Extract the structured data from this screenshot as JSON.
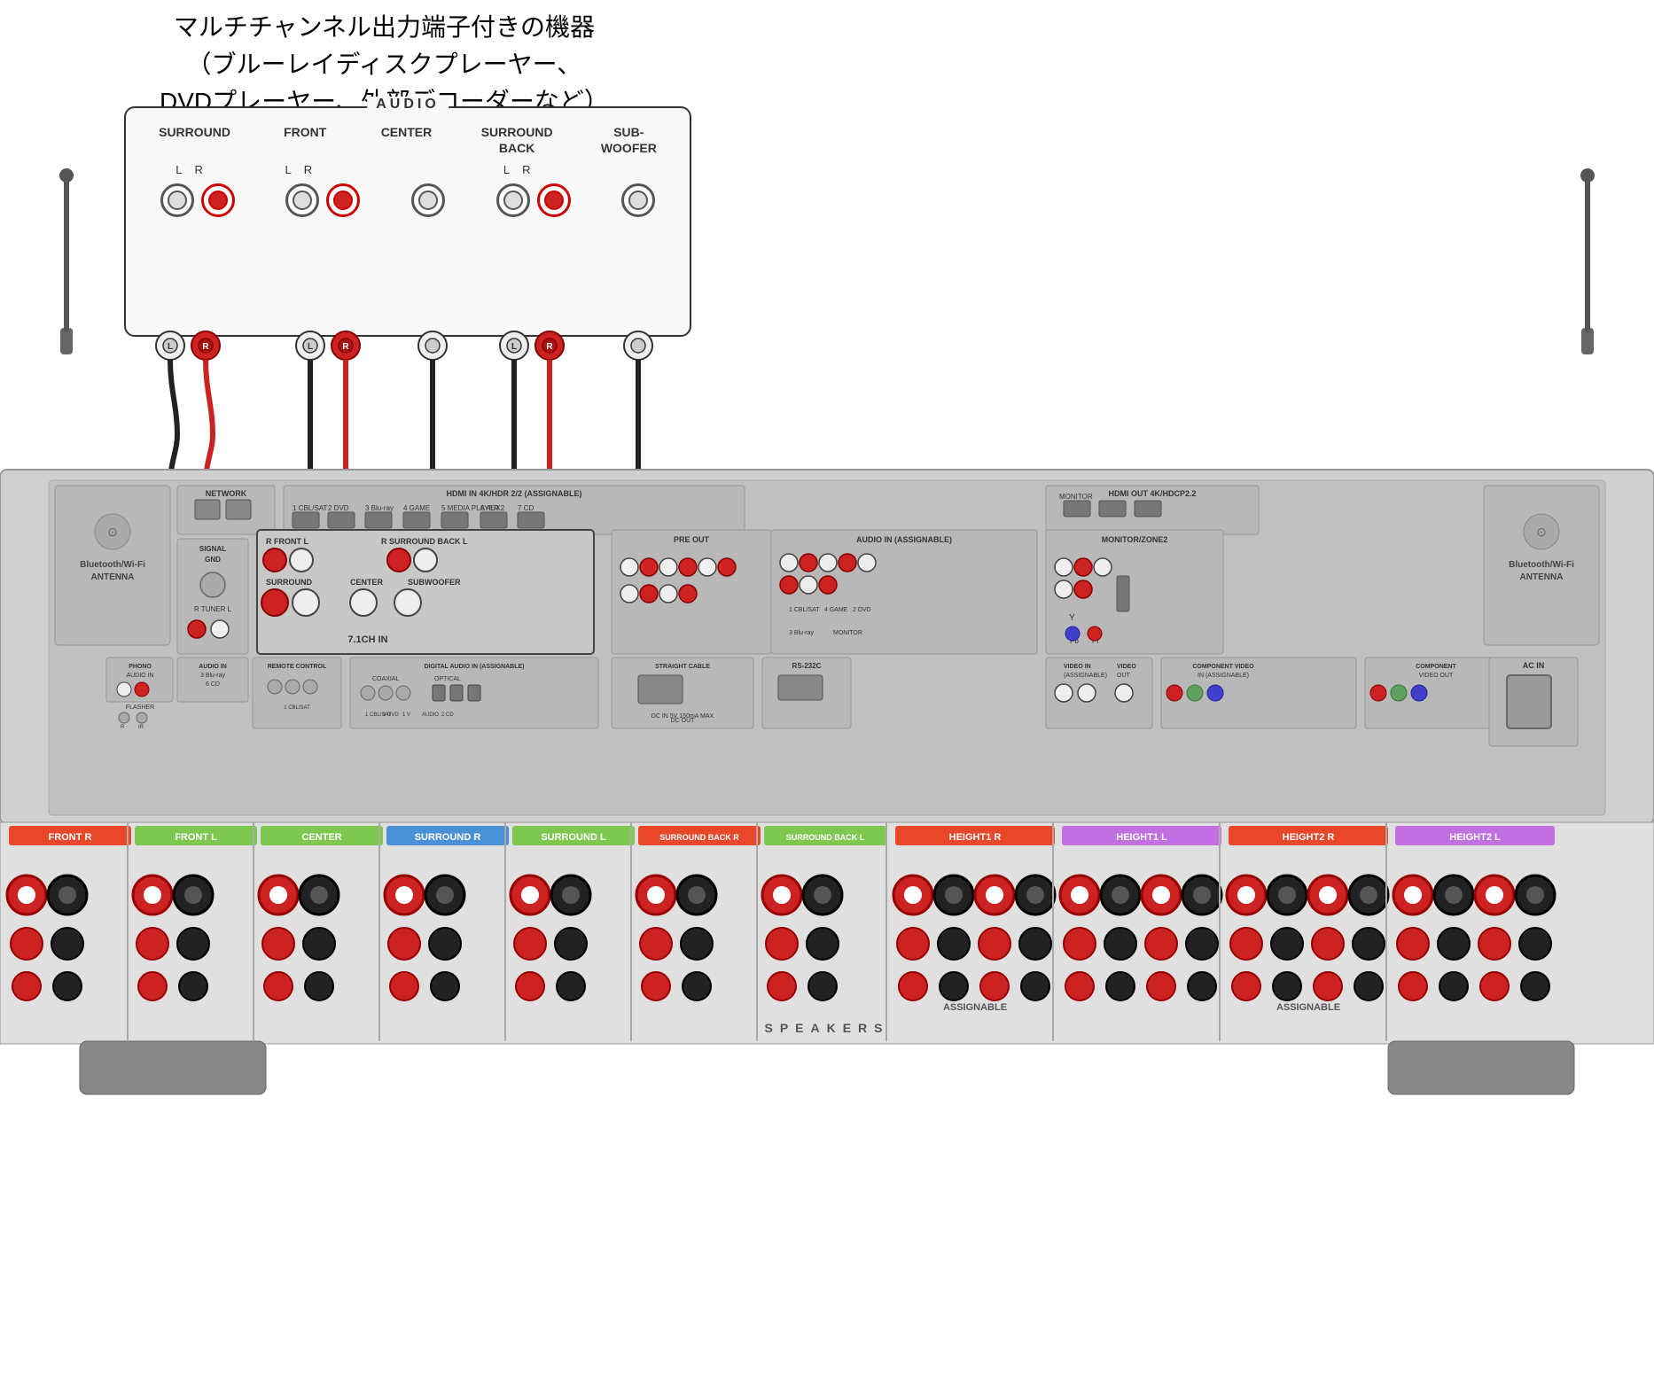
{
  "title": {
    "line1": "マルチチャンネル出力端子付きの機器",
    "line2": "（ブルーレイディスクプレーヤー、",
    "line3": "DVDプレーヤー、外部デコーダーなど）"
  },
  "source_panel": {
    "audio_label": "AUDIO",
    "channels": [
      {
        "name": "SURROUND",
        "has_lr": true
      },
      {
        "name": "FRONT",
        "has_lr": true
      },
      {
        "name": "CENTER",
        "has_lr": false
      },
      {
        "name": "SURROUND\nBACK",
        "has_lr": true
      },
      {
        "name": "SUB-\nWOOFER",
        "has_lr": false
      }
    ]
  },
  "receiver": {
    "network_label": "NETWORK",
    "hdmi_in_label": "HDMI IN 4K/HDR",
    "hdmi_out_label": "HDMI OUT 4K/HDCP2.2",
    "monitor_label": "MONITOR",
    "signal_gnd_label": "SIGNAL\nGND",
    "tuner_label": "TUNER",
    "audio_in_label": "AUDIO IN",
    "audio_in_assignable_label": "AUDIO IN (ASSIGNABLE)",
    "phono_label": "PHONO\nAUDIO IN",
    "flasher_label": "FLASHER",
    "remote_control_label": "REMOTE CONTROL",
    "digital_audio_label": "DIGITAL AUDIO IN (ASSIGNABLE)",
    "coaxial_label": "COAXIAL",
    "optical_label": "OPTICAL",
    "pre_out_label": "PRE OUT",
    "straight_cable_label": "STRAIGHT CABLE",
    "dc_out_label": "DC OUT",
    "rs232c_label": "RS-232C",
    "video_in_label": "VIDEO IN\n(ASSIGNABLE)",
    "video_out_label": "VIDEO\nOUT",
    "component_in_label": "COMPONENT VIDEO\nIN\n(ASSIGNABLE)",
    "component_out_label": "COMPONENT\nVIDEO OUT",
    "zone2_label": "MONITOR/ZONE2",
    "7_1ch_label": "7.1CH IN",
    "bt_wifi_left_label": "Bluetooth/Wi-Fi\nANTENNA",
    "bt_wifi_right_label": "Bluetooth/Wi-Fi\nANTENNA",
    "ac_in_label": "AC IN",
    "inputs": [
      "1 CBL/SAT",
      "2 DVD",
      "3 Blu-ray",
      "4 GAME",
      "5 MEDIA PLAYER",
      "6 AUX2",
      "7 CD"
    ]
  },
  "speakers": {
    "channels": [
      {
        "name": "FRONT R",
        "color": "#e8472a"
      },
      {
        "name": "FRONT L",
        "color": "#7ec850"
      },
      {
        "name": "CENTER",
        "color": "#7ec850"
      },
      {
        "name": "SURROUND R",
        "color": "#4a90d9"
      },
      {
        "name": "SURROUND L",
        "color": "#7ec850"
      },
      {
        "name": "SURROUND BACK R",
        "color": "#e8472a"
      },
      {
        "name": "SURROUND BACK L",
        "color": "#7ec850"
      },
      {
        "name": "HEIGHT1 R",
        "color": "#e8472a"
      },
      {
        "name": "HEIGHT1 L",
        "color": "#c070e0"
      },
      {
        "name": "HEIGHT2 R",
        "color": "#e8472a"
      },
      {
        "name": "HEIGHT2 L",
        "color": "#c070e0"
      }
    ],
    "label": "SPEAKERS",
    "assignable_label1": "ASSIGNABLE",
    "assignable_label2": "ASSIGNABLE"
  },
  "cable_groups": [
    {
      "id": "surround",
      "label": "L R",
      "color": "red"
    },
    {
      "id": "front",
      "label": "L R",
      "color": "red"
    },
    {
      "id": "center",
      "label": "",
      "color": "white"
    },
    {
      "id": "surround_back",
      "label": "L R",
      "color": "red"
    },
    {
      "id": "subwoofer",
      "label": "",
      "color": "white"
    }
  ]
}
